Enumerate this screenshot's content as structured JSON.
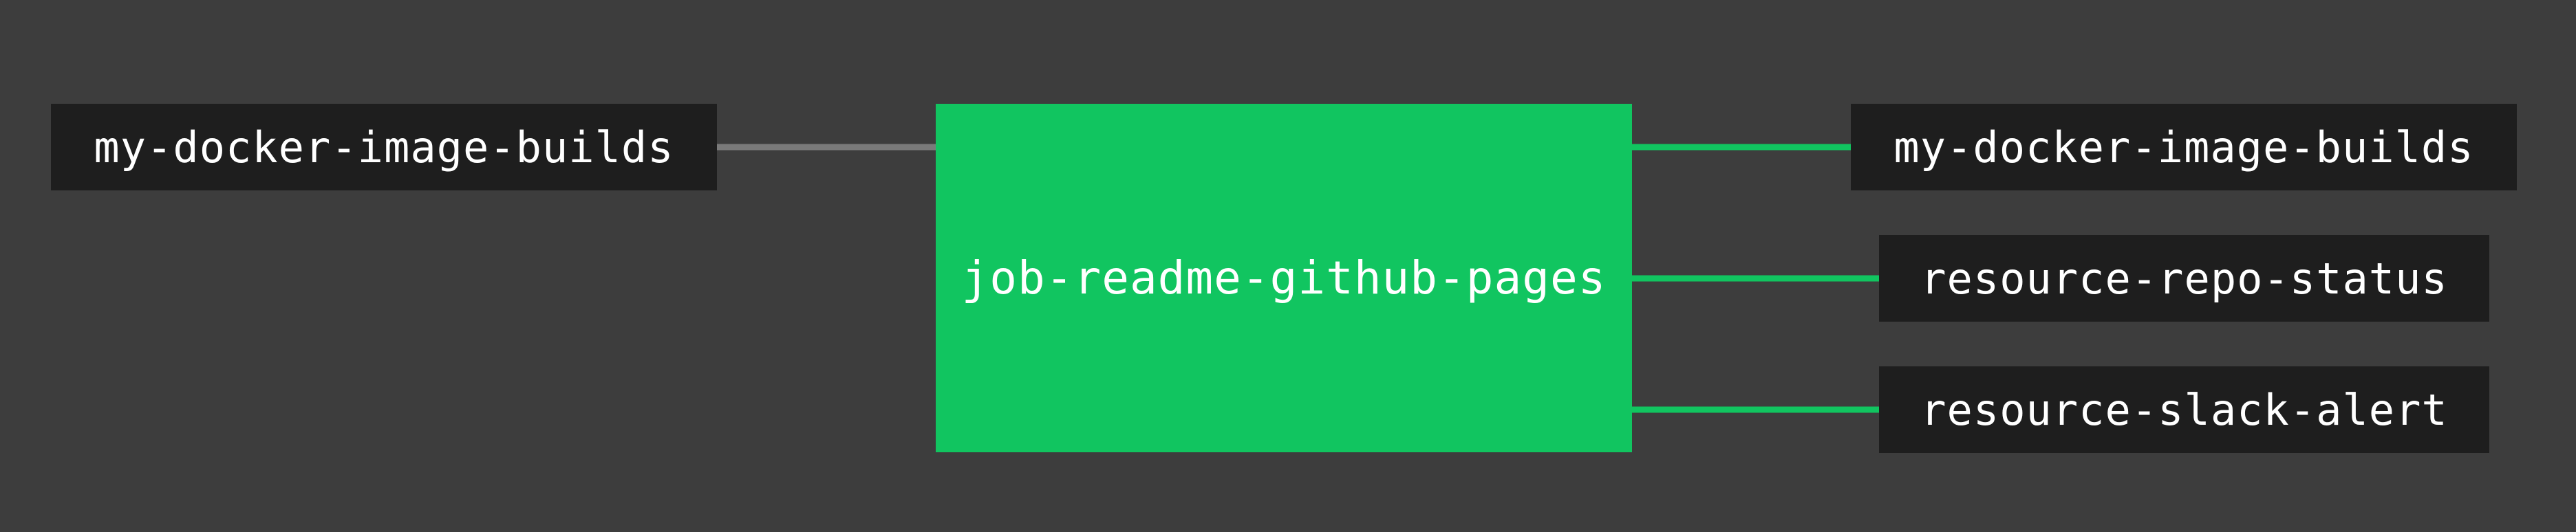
{
  "colors": {
    "background": "#3d3d3d",
    "resource_fill": "#1e1e1e",
    "job_fill": "#11c560",
    "input_wire": "#7a7a7a",
    "output_wire": "#11c560",
    "text": "#ffffff"
  },
  "pipeline": {
    "inputs": [
      {
        "label": "my-docker-image-builds"
      }
    ],
    "job": {
      "label": "job-readme-github-pages",
      "status": "succeeded"
    },
    "outputs": [
      {
        "label": "my-docker-image-builds"
      },
      {
        "label": "resource-repo-status"
      },
      {
        "label": "resource-slack-alert"
      }
    ]
  }
}
